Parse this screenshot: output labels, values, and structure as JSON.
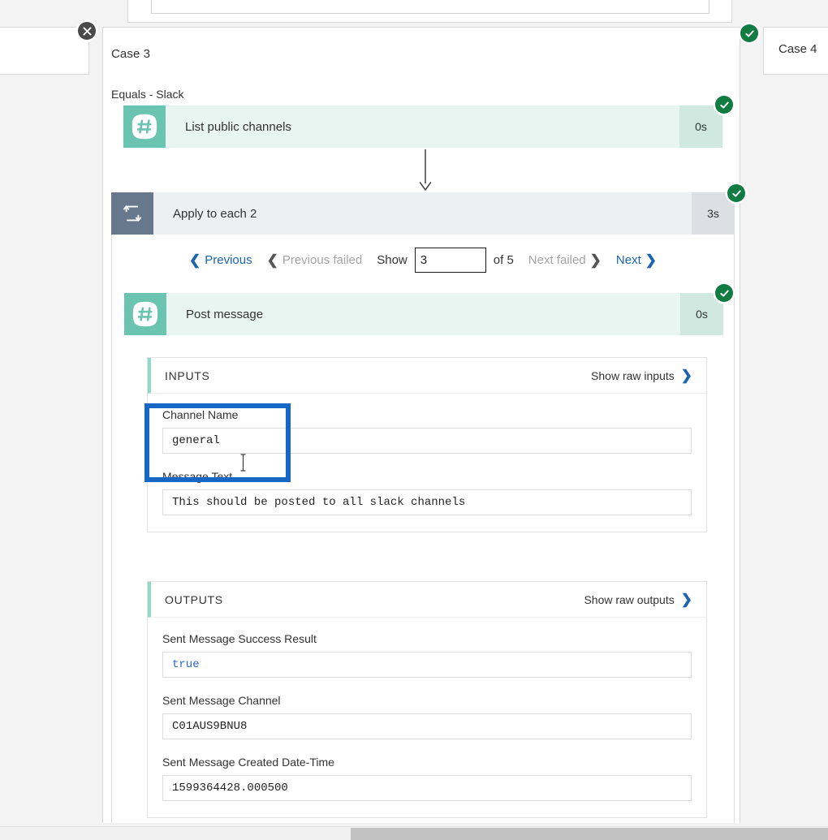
{
  "colors": {
    "accent_blue": "#1a64b0",
    "annotation_blue": "#1668c4",
    "success_green": "#107c41",
    "slack_teal": "#6bc4b0",
    "loop_slate": "#67788c"
  },
  "neighbor_left": {
    "close_icon": "close-icon"
  },
  "neighbor_right": {
    "title": "Case 4"
  },
  "case3": {
    "title": "Case 3",
    "condition": "Equals - Slack",
    "status_icon": "check-circle-icon"
  },
  "actions": {
    "list_channels": {
      "icon": "slack-hash-icon",
      "label": "List public channels",
      "duration": "0s",
      "status_icon": "check-circle-icon"
    },
    "apply_to_each": {
      "icon": "loop-repeat-icon",
      "label": "Apply to each 2",
      "duration": "3s",
      "status_icon": "check-circle-icon"
    },
    "post_message": {
      "icon": "slack-hash-icon",
      "label": "Post message",
      "duration": "0s",
      "status_icon": "check-circle-icon"
    }
  },
  "pager": {
    "previous_label": "Previous",
    "previous_failed_label": "Previous failed",
    "show_label": "Show",
    "current_value": "3",
    "of_label": "of 5",
    "next_failed_label": "Next failed",
    "next_label": "Next",
    "chevron_left": "❮",
    "chevron_right": "❯"
  },
  "inputs_panel": {
    "title": "INPUTS",
    "raw_label": "Show raw inputs",
    "fields": [
      {
        "label": "Channel Name",
        "value": "general"
      },
      {
        "label": "Message Text",
        "value": "This should be posted to all slack channels"
      }
    ]
  },
  "outputs_panel": {
    "title": "OUTPUTS",
    "raw_label": "Show raw outputs",
    "fields": [
      {
        "label": "Sent Message Success Result",
        "value": "true"
      },
      {
        "label": "Sent Message Channel",
        "value": "C01AUS9BNU8"
      },
      {
        "label": "Sent Message Created Date-Time",
        "value": "1599364428.000500"
      }
    ]
  },
  "annotation": {
    "target": "channel-name-field",
    "shape": "rectangle-outline"
  },
  "scrollbar": {
    "orientation": "horizontal"
  }
}
